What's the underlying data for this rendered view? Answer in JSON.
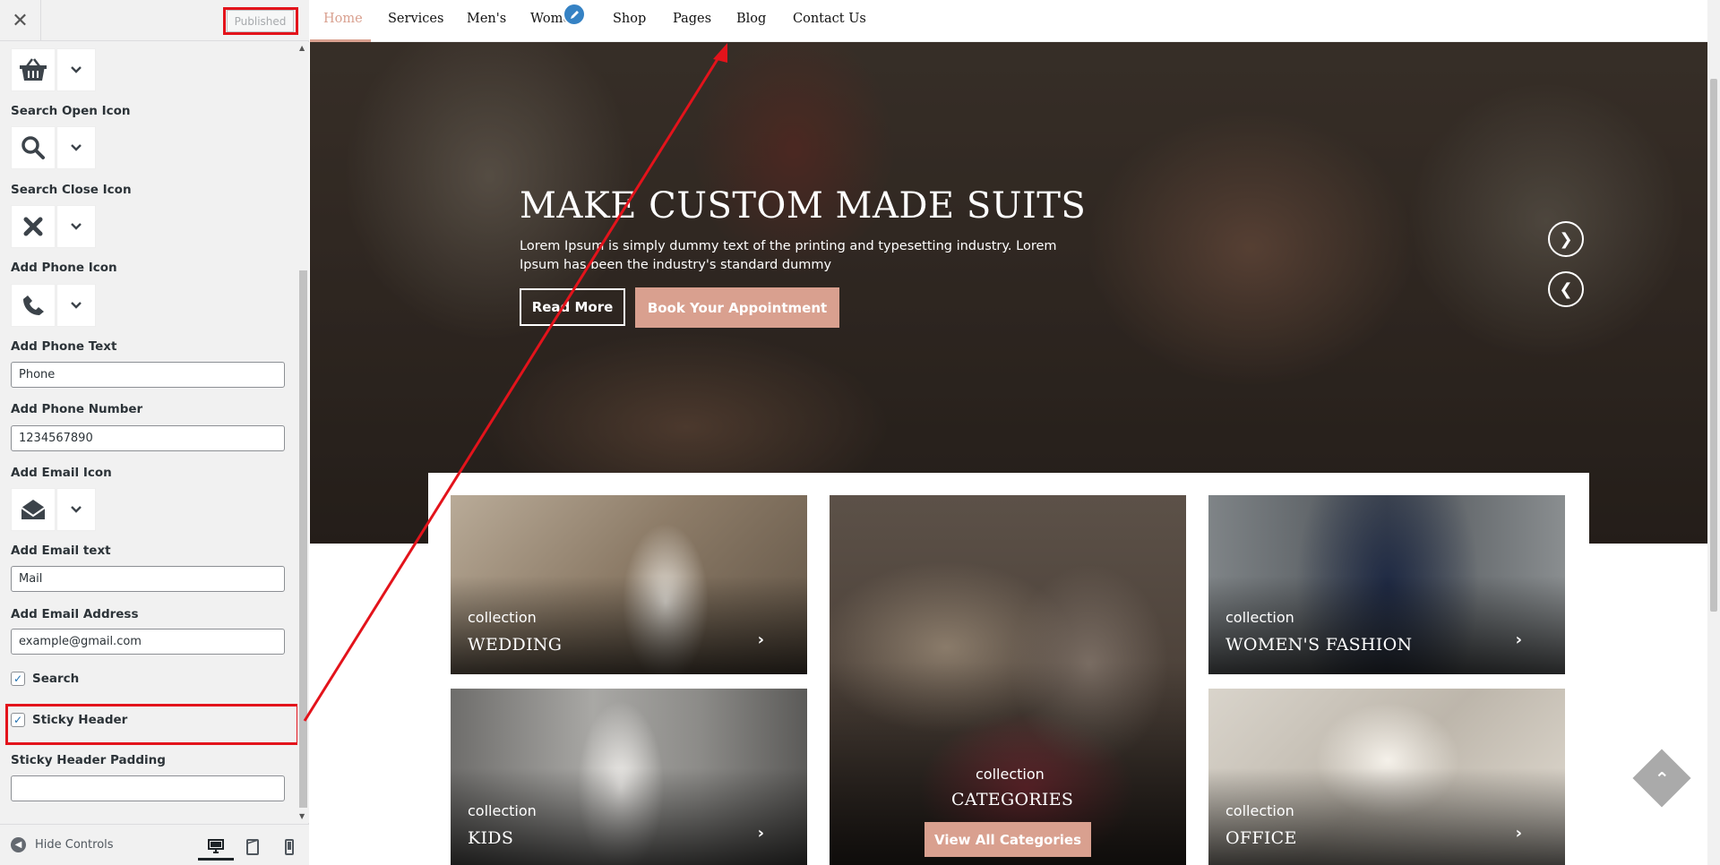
{
  "customizer": {
    "close_glyph": "✕",
    "publish_label": "Published",
    "labels": {
      "search_open_icon": "Search Open Icon",
      "search_close_icon": "Search Close Icon",
      "add_phone_icon": "Add Phone Icon",
      "add_phone_text": "Add Phone Text",
      "add_phone_number": "Add Phone Number",
      "add_email_icon": "Add Email Icon",
      "add_email_text": "Add Email text",
      "add_email_address": "Add Email Address",
      "sticky_header_padding": "Sticky Header Padding"
    },
    "icons": {
      "cart": "shopping-basket-icon",
      "search_open": "search-icon",
      "search_close": "close-icon",
      "phone": "phone-icon",
      "email": "envelope-open-icon"
    },
    "inputs": {
      "phone_text": "Phone",
      "phone_number": "1234567890",
      "email_text": "Mail",
      "email_address": "example@gmail.com",
      "sticky_header_padding": ""
    },
    "checkboxes": {
      "search": {
        "label": "Search",
        "checked": true
      },
      "sticky_header": {
        "label": "Sticky Header",
        "checked": true
      }
    },
    "footer": {
      "hide_controls_label": "Hide Controls",
      "devices": [
        "desktop",
        "tablet",
        "mobile"
      ],
      "active_device": "desktop"
    }
  },
  "site": {
    "nav": [
      {
        "label": "Home",
        "active": true
      },
      {
        "label": "Services"
      },
      {
        "label": "Men's"
      },
      {
        "label": "Wome"
      },
      {
        "label": "Shop"
      },
      {
        "label": "Pages"
      },
      {
        "label": "Blog"
      },
      {
        "label": "Contact Us"
      }
    ],
    "hero": {
      "title": "MAKE CUSTOM MADE SUITS",
      "description": "Lorem Ipsum is simply dummy text of the printing and typesetting industry. Lorem Ipsum has been the industry's standard dummy",
      "read_more": "Read More",
      "book": "Book Your Appointment",
      "next_glyph": "❯",
      "prev_glyph": "❮"
    },
    "categories": [
      {
        "small": "collection",
        "big": "WEDDING"
      },
      {
        "small": "collection",
        "big": "CATEGORIES",
        "button": "View All Categories"
      },
      {
        "small": "collection",
        "big": "WOMEN'S FASHION"
      },
      {
        "small": "collection",
        "big": "KIDS"
      },
      {
        "small": "collection",
        "big": "OFFICE"
      }
    ],
    "chevron_glyph": "›",
    "scroll_top_glyph": "⌃"
  },
  "colors": {
    "accent": "#d9a08f",
    "annotation_red": "#e3131b",
    "wp_blue": "#2271b1"
  }
}
